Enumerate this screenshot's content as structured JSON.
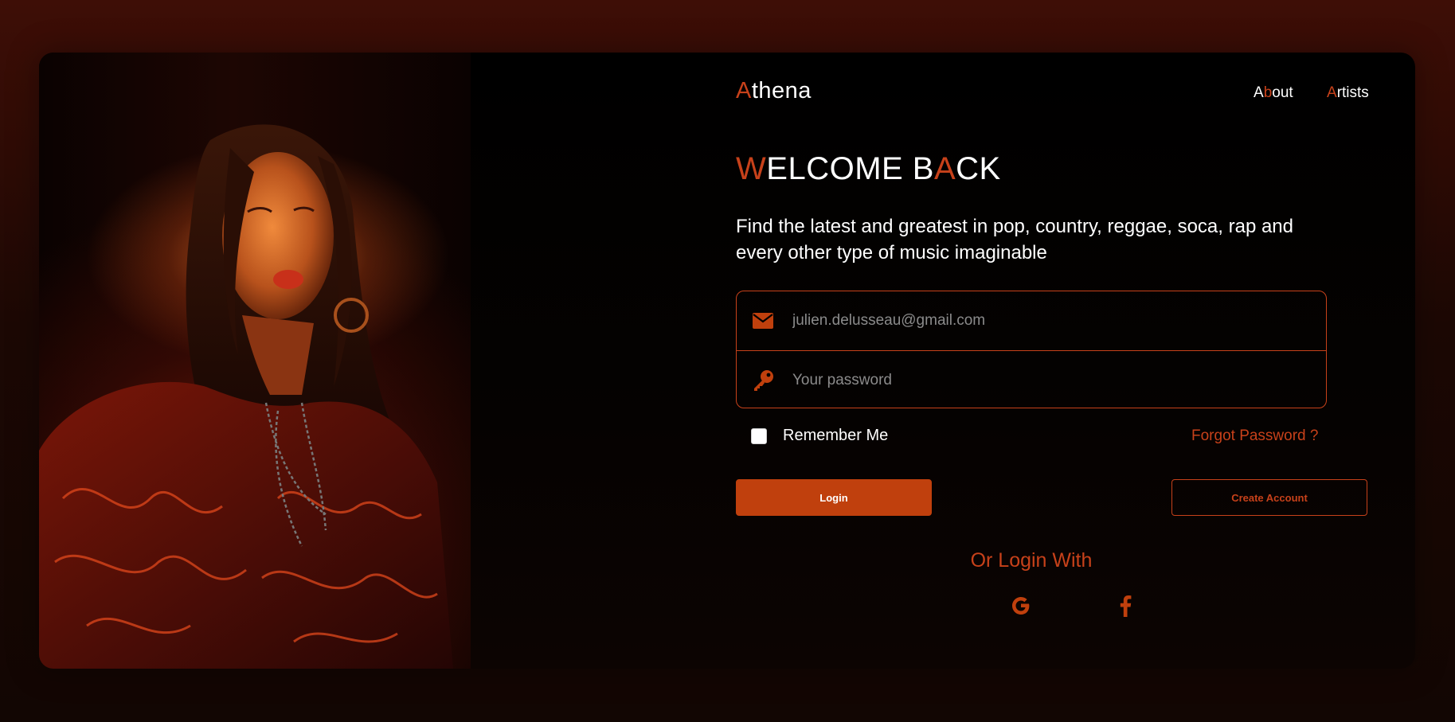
{
  "brand": {
    "first_letter": "A",
    "rest": "thena"
  },
  "nav": {
    "about": {
      "a": "A",
      "b": "b",
      "rest": "out"
    },
    "artists": {
      "a": "A",
      "rest": "rtists"
    }
  },
  "heading": {
    "w": "W",
    "part1": "ELCOME B",
    "a": "A",
    "part2": "CK"
  },
  "tagline": "Find the latest and greatest in pop, country, reggae, soca, rap and every other type of music imaginable",
  "form": {
    "email_placeholder": "julien.delusseau@gmail.com",
    "password_placeholder": "Your password",
    "remember_label": "Remember Me",
    "remember_checked": false,
    "forgot_label": "Forgot Password ?",
    "login_label": "Login",
    "create_label": "Create Account"
  },
  "social": {
    "heading": "Or Login With",
    "providers": [
      "google-icon",
      "facebook-icon"
    ]
  },
  "colors": {
    "accent": "#c7411a",
    "button": "#c0400d",
    "background_top": "#3e0e06"
  }
}
